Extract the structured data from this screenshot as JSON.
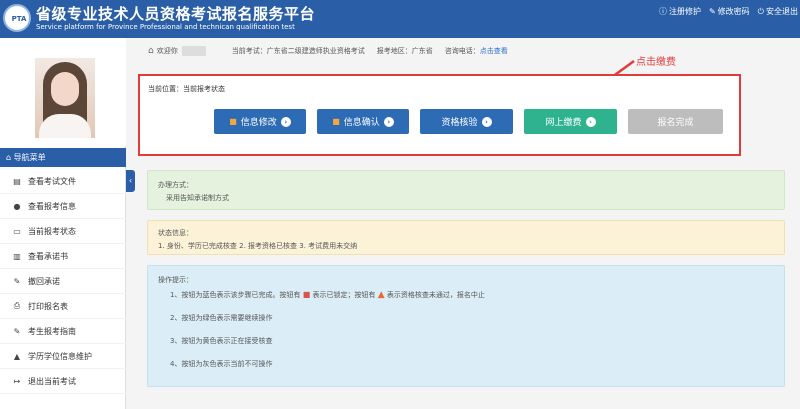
{
  "header": {
    "title_cn": "省级专业技术人员资格考试报名服务平台",
    "title_en": "Service platform for Province Professional and technican qualification test",
    "logo_text": "PTA",
    "links": [
      {
        "icon": "info-icon",
        "label": "注册修护"
      },
      {
        "icon": "edit-icon",
        "label": "修改密码"
      },
      {
        "icon": "power-icon",
        "label": "安全退出"
      }
    ]
  },
  "infobar": {
    "welcome": "欢迎你",
    "current_exam": "当前考试：广东省二级建造师执业资格考试",
    "region": "报考地区：广东省",
    "phone_label": "咨询电话：",
    "phone_link": "点击查看"
  },
  "sidebar": {
    "nav_title": "导航菜单",
    "items": [
      {
        "icon": "document-icon",
        "label": "查看考试文件"
      },
      {
        "icon": "info-circle-icon",
        "label": "查看报考信息"
      },
      {
        "icon": "monitor-icon",
        "label": "当前报考状态"
      },
      {
        "icon": "book-icon",
        "label": "查看承诺书"
      },
      {
        "icon": "pen-icon",
        "label": "撤回承诺"
      },
      {
        "icon": "printer-icon",
        "label": "打印报名表"
      },
      {
        "icon": "pen-icon",
        "label": "考生报考指南"
      },
      {
        "icon": "graduation-cap-icon",
        "label": "学历学位信息维护"
      },
      {
        "icon": "logout-icon",
        "label": "退出当前考试"
      }
    ]
  },
  "status": {
    "crumb": "当前位置：当前报考状态",
    "steps": [
      {
        "label": "信息修改",
        "style": "blue",
        "lock": true,
        "go": true
      },
      {
        "label": "信息确认",
        "style": "blue",
        "lock": true,
        "go": true
      },
      {
        "label": "资格核验",
        "style": "blue",
        "lock": false,
        "go": true
      },
      {
        "label": "网上缴费",
        "style": "green",
        "lock": false,
        "go": true
      },
      {
        "label": "报名完成",
        "style": "gray",
        "lock": false,
        "go": false
      }
    ],
    "annotation": "点击缴费"
  },
  "boxes": {
    "method_title": "办理方式：",
    "method_value": "采用告知承诺制方式",
    "state_title": "状态信息：",
    "state_value": "1. 身份、学历已完成核查 2. 报考资格已核查 3. 考试费用未交纳",
    "tips_title": "操作提示：",
    "tip1_a": "1、按钮为蓝色表示该步骤已完成。按钮有",
    "tip1_b": "表示已锁定；按钮有",
    "tip1_c": "表示资格核查未通过，报名中止",
    "tip2": "2、按钮为绿色表示需要继续操作",
    "tip3": "3、按钮为黄色表示正在接受核查",
    "tip4": "4、按钮为灰色表示当前不可操作"
  },
  "colors": {
    "header": "#2a5fa8",
    "step_blue": "#2d6cb5",
    "step_green": "#2fb38f",
    "step_gray": "#bdbdbd",
    "highlight": "#e23b3b"
  }
}
